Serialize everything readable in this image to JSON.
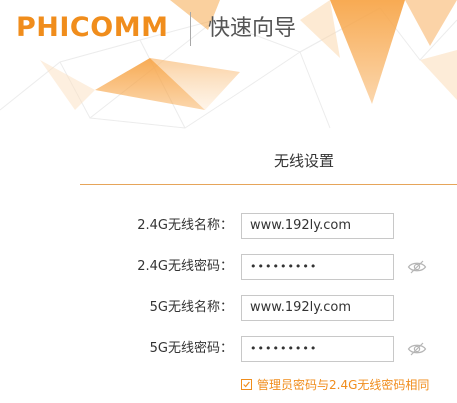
{
  "header": {
    "logo_text": "PHICOMM",
    "wizard_title": "快速向导"
  },
  "section": {
    "title": "无线设置"
  },
  "form": {
    "rows": [
      {
        "label": "2.4G无线名称：",
        "value": "www.192ly.com"
      },
      {
        "label": "2.4G无线密码：",
        "value": "•••••••••"
      },
      {
        "label": "5G无线名称：",
        "value": "www.192ly.com"
      },
      {
        "label": "5G无线密码：",
        "value": "•••••••••"
      }
    ],
    "sync_checkbox": {
      "label": "管理员密码与2.4G无线密码相同",
      "checked": true
    }
  },
  "icons": {
    "password_visibility": "eye-slash-icon",
    "checkbox": "checkmark-icon"
  },
  "colors": {
    "brand": "#f08d1c",
    "section_line": "#e6a55a",
    "input_border": "#c8c8c8"
  }
}
